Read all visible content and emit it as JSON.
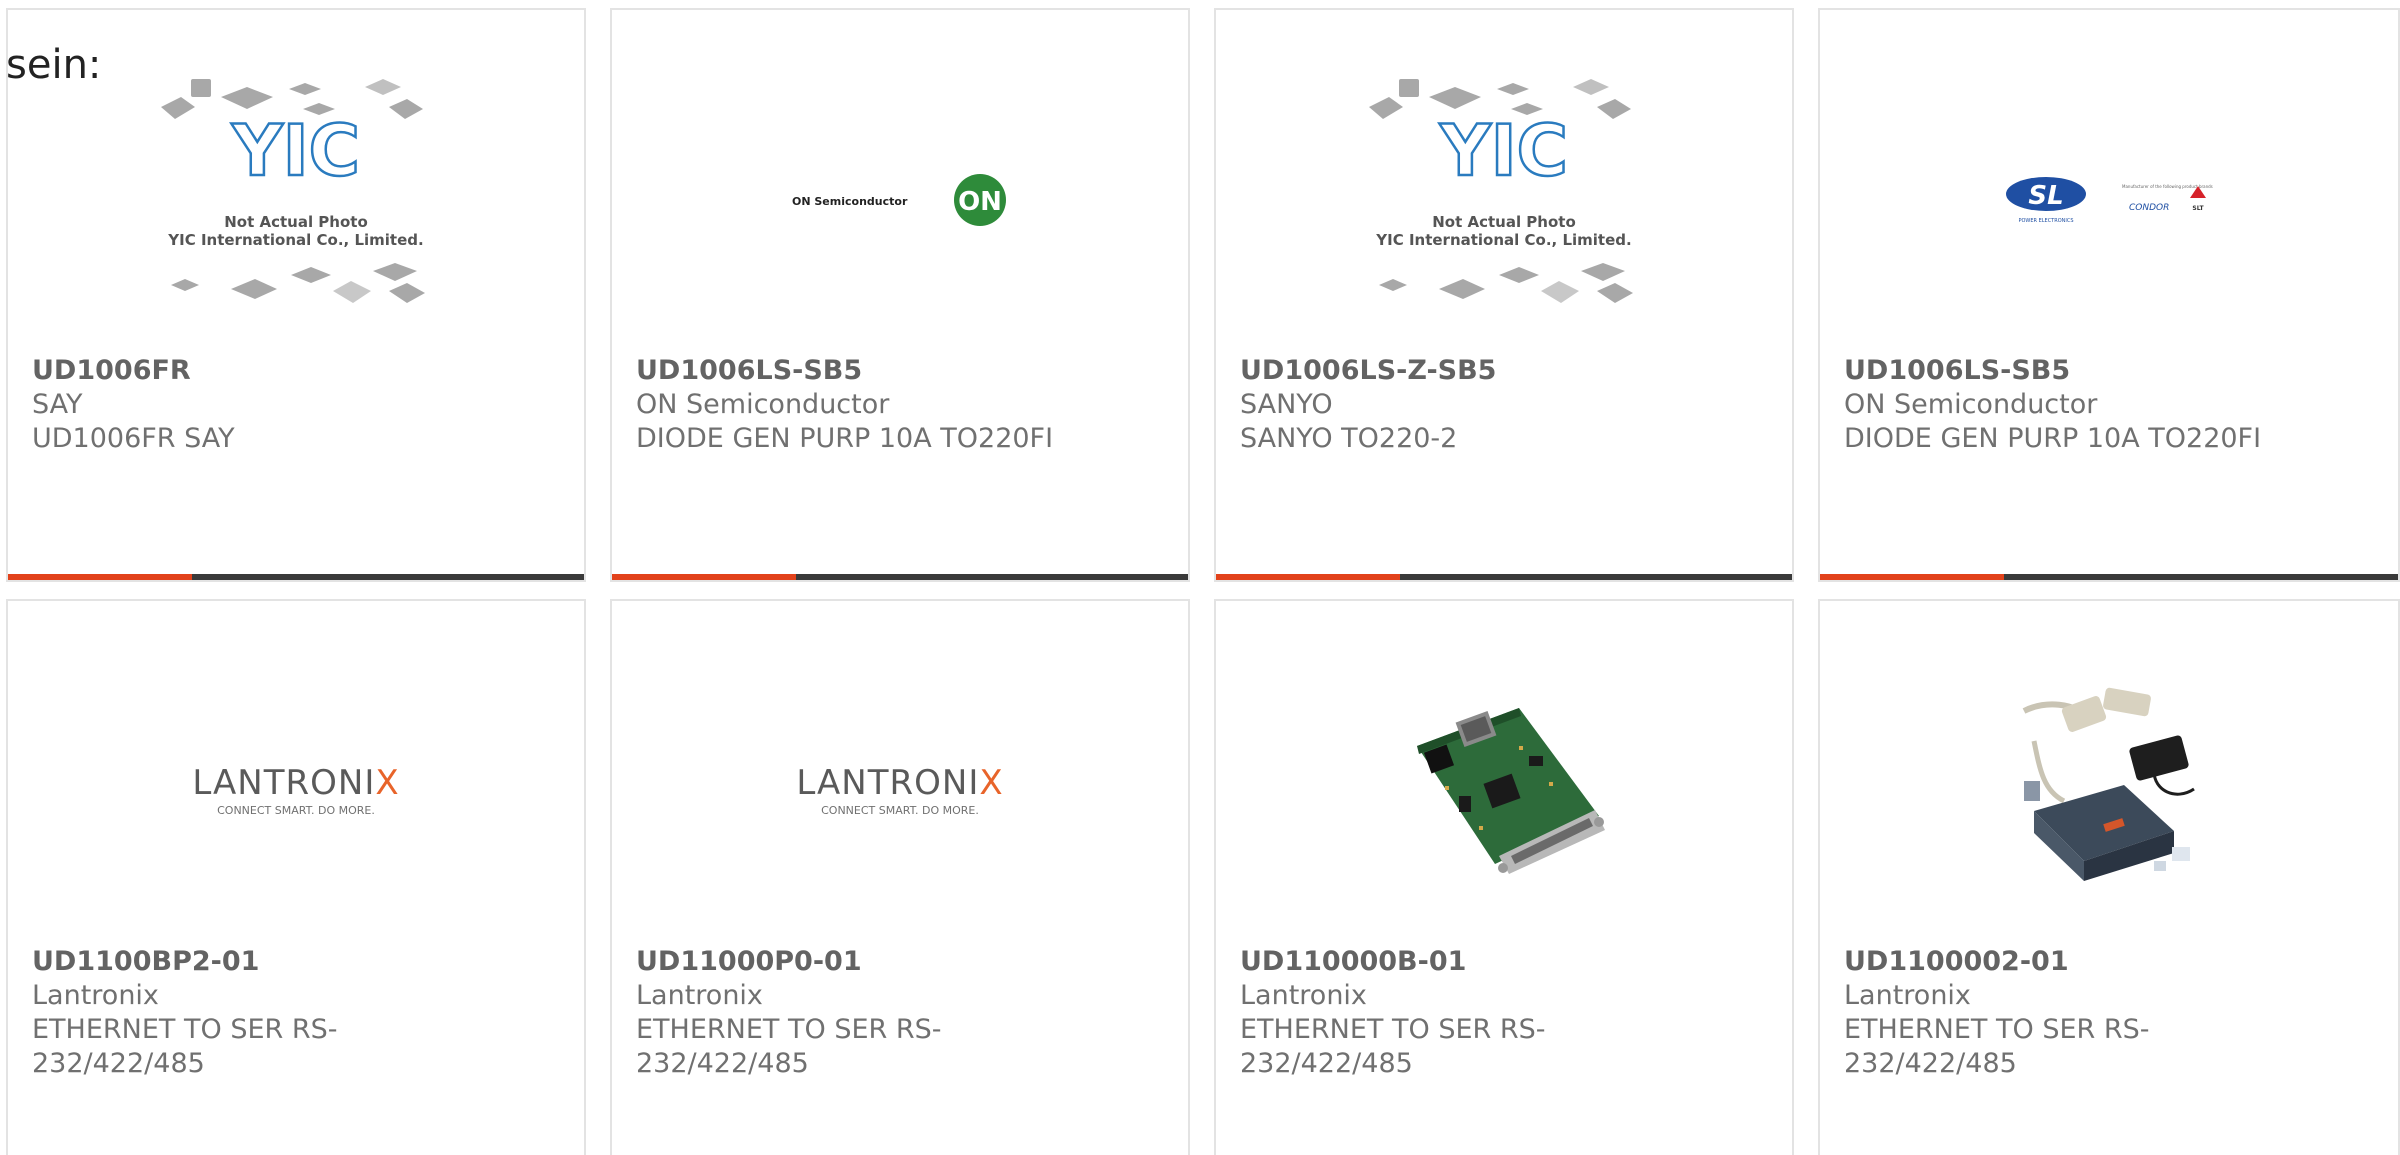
{
  "intro_text": "sein:",
  "yic_image": {
    "brand": "YIC",
    "caption_line1": "Not Actual Photo",
    "caption_line2": "YIC International Co., Limited."
  },
  "on_logo": {
    "text": "ON Semiconductor",
    "mark": "ON"
  },
  "sl_logo": {
    "mark": "SL",
    "line": "POWER ELECTRONICS",
    "tag": "Manufacturer of the following product brands",
    "brand": "CONDOR",
    "brand2": "SLT"
  },
  "lantronix_logo": {
    "name_main": "LANTRONI",
    "name_accent": "X",
    "tagline": "CONNECT SMART. DO MORE."
  },
  "colors": {
    "accent_red": "#e2421b",
    "accent_dark": "#3a3a3a",
    "card_border": "#e3e3e3",
    "text_gray": "#707070",
    "on_green": "#2e8b3a",
    "sl_blue": "#1f4fa3",
    "lantronix_orange": "#e8642a"
  },
  "products": [
    {
      "part_number": "UD1006FR",
      "manufacturer": "SAY",
      "description": "UD1006FR SAY",
      "image": "yic-placeholder"
    },
    {
      "part_number": "UD1006LS-SB5",
      "manufacturer": "ON Semiconductor",
      "description": "DIODE GEN PURP 10A TO220FI",
      "image": "on-semiconductor-logo"
    },
    {
      "part_number": "UD1006LS-Z-SB5",
      "manufacturer": "SANYO",
      "description": "SANYO TO220-2",
      "image": "yic-placeholder"
    },
    {
      "part_number": "UD1006LS-SB5",
      "manufacturer": "ON Semiconductor",
      "description": "DIODE GEN PURP 10A TO220FI",
      "image": "sl-power-logo"
    },
    {
      "part_number": "UD1100BP2-01",
      "manufacturer": "Lantronix",
      "description_line1": "ETHERNET TO SER RS-",
      "description_line2": "232/422/485",
      "image": "lantronix-logo"
    },
    {
      "part_number": "UD11000P0-01",
      "manufacturer": "Lantronix",
      "description_line1": "ETHERNET TO SER RS-",
      "description_line2": "232/422/485",
      "image": "lantronix-logo"
    },
    {
      "part_number": "UD110000B-01",
      "manufacturer": "Lantronix",
      "description_line1": "ETHERNET TO SER RS-",
      "description_line2": "232/422/485",
      "image": "circuit-board-photo"
    },
    {
      "part_number": "UD1100002-01",
      "manufacturer": "Lantronix",
      "description_line1": "ETHERNET TO SER RS-",
      "description_line2": "232/422/485",
      "image": "device-server-kit-photo"
    }
  ]
}
